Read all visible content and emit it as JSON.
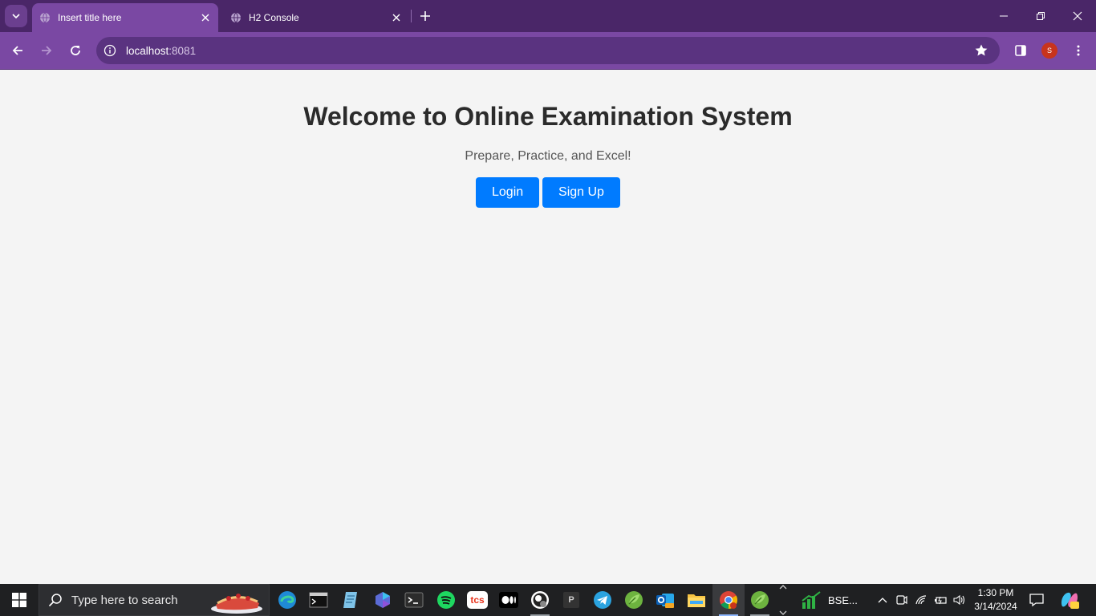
{
  "browser": {
    "tabs": [
      {
        "label": "Insert title here",
        "active": true
      },
      {
        "label": "H2 Console",
        "active": false
      }
    ],
    "address": {
      "host": "localhost",
      "port": ":8081"
    },
    "profile_initial": "S",
    "accent_color": "#7a48a3"
  },
  "page": {
    "title": "Welcome to Online Examination System",
    "tagline": "Prepare, Practice, and Excel!",
    "buttons": {
      "login": "Login",
      "signup": "Sign Up"
    },
    "button_color": "#007bff"
  },
  "taskbar": {
    "search_placeholder": "Type here to search",
    "apps": [
      "edge-icon",
      "terminal-icon",
      "notepad-icon",
      "copilot-app-icon",
      "windows-terminal-icon",
      "spotify-icon",
      "tcs-icon",
      "medium-icon",
      "github-desktop-icon",
      "jetbrains-p-icon",
      "telegram-icon",
      "spring-tool-icon",
      "outlook-icon",
      "file-explorer-icon",
      "chrome-icon",
      "spring-tool-2-icon"
    ],
    "tcs_label": "tcs",
    "p_label": "P",
    "stock_label": "BSE...",
    "time": "1:30 PM",
    "date": "3/14/2024"
  }
}
